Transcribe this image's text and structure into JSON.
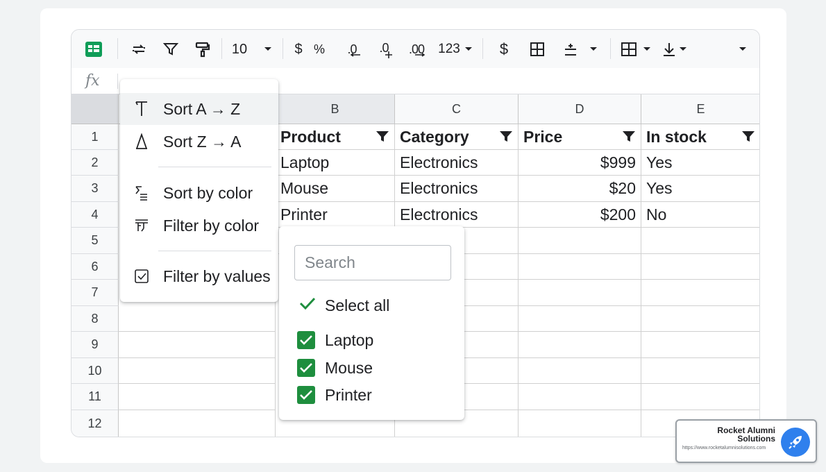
{
  "toolbar": {
    "font_size": "10",
    "currency_symbol": "$",
    "percent_symbol": "%",
    "decrease_decimals": ".0",
    "increase_decimals": ".0",
    "decimal_places": ".00",
    "number_format": "123",
    "currency_symbol_2": "$"
  },
  "formula_bar": {
    "label": "fx"
  },
  "columns": [
    "B",
    "C",
    "D",
    "E"
  ],
  "rows": [
    "1",
    "2",
    "3",
    "4",
    "5",
    "6",
    "7",
    "8",
    "9",
    "10",
    "11",
    "12"
  ],
  "table": {
    "headers": [
      "Product",
      "Category",
      "Price",
      "In stock"
    ],
    "rows": [
      [
        "Laptop",
        "Electronics",
        "$999",
        "Yes"
      ],
      [
        "Mouse",
        "Electronics",
        "$20",
        "Yes"
      ],
      [
        "Printer",
        "Electronics",
        "$200",
        "No"
      ]
    ]
  },
  "sort_menu": {
    "items": [
      "Sort A → Z",
      "Sort Z → A",
      "Sort by color",
      "Filter by color",
      "Filter by values"
    ]
  },
  "filter_popup": {
    "search_placeholder": "Search",
    "select_all": "Select all",
    "options": [
      "Laptop",
      "Mouse",
      "Printer"
    ]
  },
  "watermark": {
    "name": "Rocket Alumni Solutions",
    "url": "https://www.rocketalumnisolutions.com"
  },
  "colors": {
    "accent_green": "#1e8e3e",
    "sheets_green": "#0f9d58",
    "logo_blue": "#2f80ed"
  }
}
